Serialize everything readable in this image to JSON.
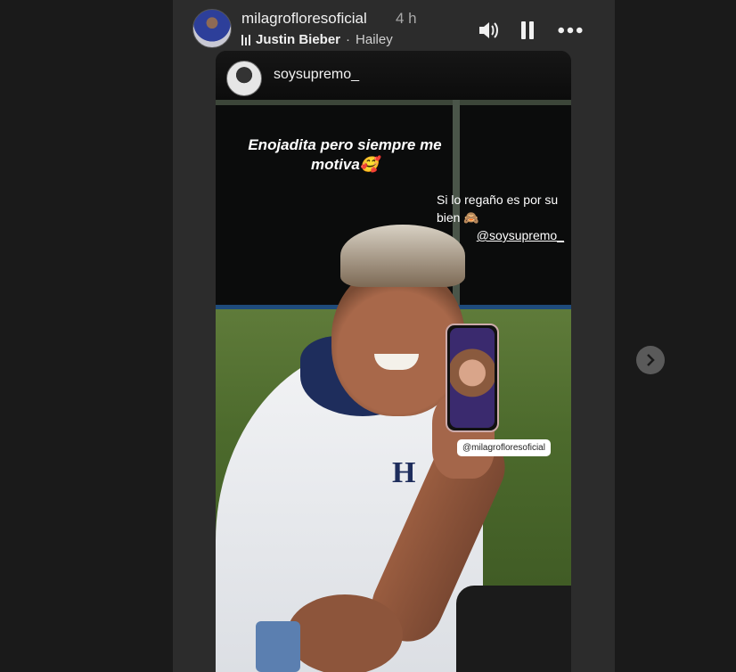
{
  "header": {
    "username": "milagrofloresoficial",
    "time": "4 h",
    "music": {
      "artist": "Justin Bieber",
      "separator": "·",
      "song": "Hailey"
    },
    "controls": [
      "speaker-icon",
      "pause-icon",
      "more-icon"
    ]
  },
  "story": {
    "shared_user": "soysupremo_",
    "caption_main": "Enojadita pero siempre me motiva🥰",
    "caption_side": "Si lo regaño es por su bien 🙈",
    "caption_mention": "@soysupremo_",
    "tag": "@milagrofloresoficial",
    "shirt_letter": "H"
  },
  "nav": {
    "next_icon": "chevron-right-icon"
  }
}
